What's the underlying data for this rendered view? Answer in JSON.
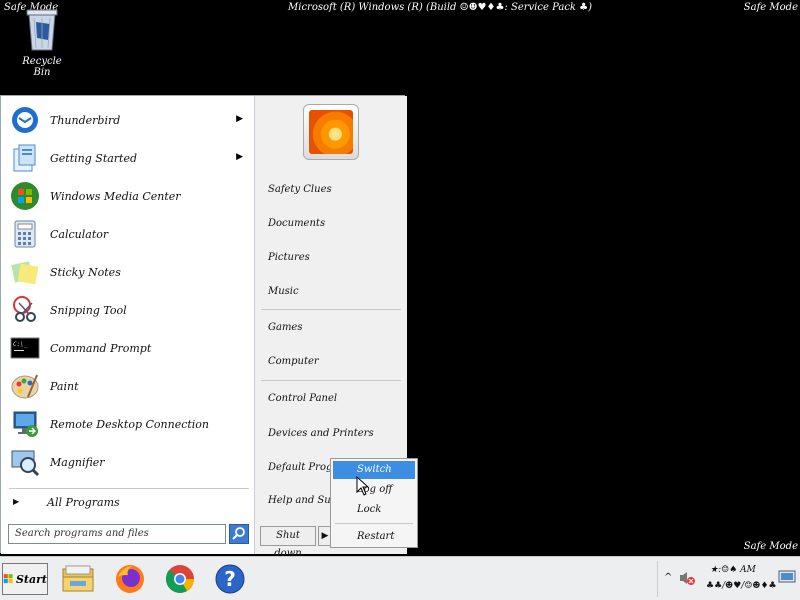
{
  "desktop": {
    "mode_left": "Safe Mode",
    "mode_right": "Safe Mode",
    "mode_bottom": "Safe Mode",
    "build": "Microsoft (R) Windows (R) (Build ☺☻♥♦♣: Service Pack ♣)",
    "recycle_bin": "Recycle Bin"
  },
  "start_menu": {
    "programs": [
      {
        "label": "Thunderbird",
        "icon": "thunderbird-icon",
        "submenu": true
      },
      {
        "label": "Getting Started",
        "icon": "getting-started-icon",
        "submenu": true
      },
      {
        "label": "Windows Media Center",
        "icon": "media-center-icon",
        "submenu": false
      },
      {
        "label": "Calculator",
        "icon": "calculator-icon",
        "submenu": false
      },
      {
        "label": "Sticky Notes",
        "icon": "sticky-notes-icon",
        "submenu": false
      },
      {
        "label": "Snipping Tool",
        "icon": "snipping-tool-icon",
        "submenu": false
      },
      {
        "label": "Command Prompt",
        "icon": "command-prompt-icon",
        "submenu": false
      },
      {
        "label": "Paint",
        "icon": "paint-icon",
        "submenu": false
      },
      {
        "label": "Remote Desktop Connection",
        "icon": "remote-desktop-icon",
        "submenu": false
      },
      {
        "label": "Magnifier",
        "icon": "magnifier-icon",
        "submenu": false
      }
    ],
    "all_programs": "All Programs",
    "search_placeholder": "Search programs and files",
    "right_links": [
      "Safety Clues",
      "Documents",
      "Pictures",
      "Music",
      "Games",
      "Computer",
      "Control Panel",
      "Devices and Printers",
      "Default Programs",
      "Help and Support"
    ],
    "shutdown_label": "Shut down"
  },
  "shutdown_submenu": {
    "items": [
      "Switch user",
      "Log off",
      "Lock",
      "Restart"
    ],
    "highlighted": "Switch user"
  },
  "taskbar": {
    "start_label": "Start",
    "pinned": [
      "explorer-icon",
      "firefox-icon",
      "chrome-icon",
      "help-icon"
    ],
    "tray": {
      "time": "★:☺♠ AM",
      "date": "♣♣/☻♥/☺☻♦♣"
    }
  },
  "colors": {
    "desktop": "#000000",
    "start_menu_left": "#ffffff",
    "start_menu_right": "#f0f0f0",
    "highlight": "#3d8ee0",
    "taskbar": "#eceef0"
  }
}
